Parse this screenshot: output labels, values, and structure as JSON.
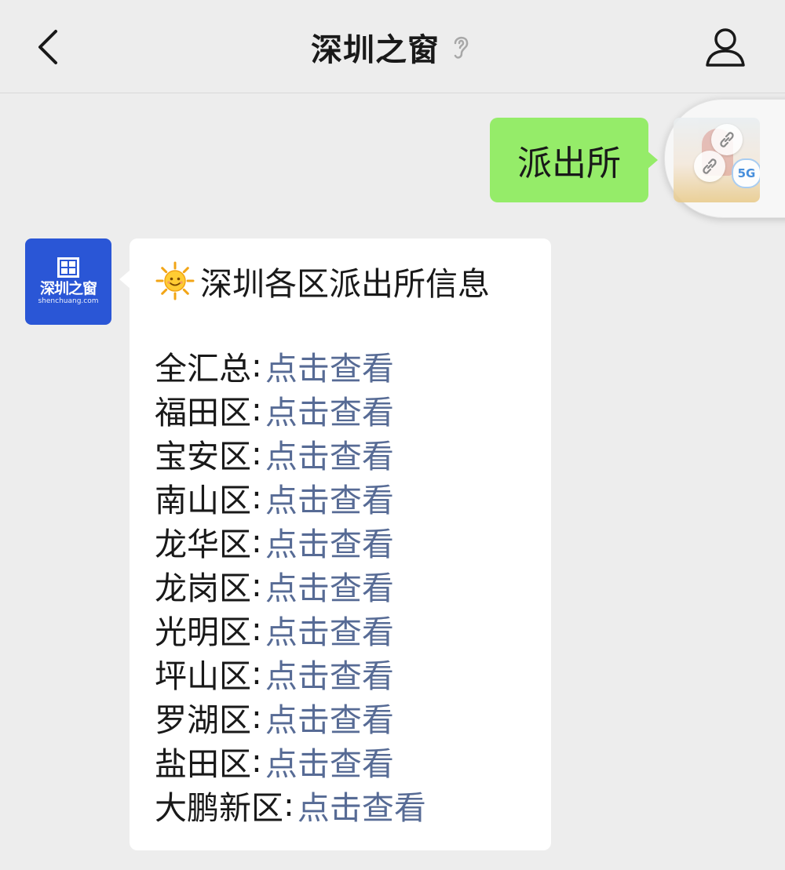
{
  "header": {
    "title": "深圳之窗"
  },
  "outgoing": {
    "text": "派出所",
    "avatar_badge": "5G"
  },
  "incoming": {
    "avatar": {
      "logo_text": "深圳之窗",
      "logo_sub": "shenchuang.com"
    },
    "heading": "深圳各区派出所信息",
    "separator": ":",
    "rows": [
      {
        "district": "全汇总",
        "link": "点击查看"
      },
      {
        "district": "福田区",
        "link": "点击查看"
      },
      {
        "district": "宝安区",
        "link": "点击查看"
      },
      {
        "district": "南山区",
        "link": "点击查看"
      },
      {
        "district": "龙华区",
        "link": "点击查看"
      },
      {
        "district": "龙岗区",
        "link": "点击查看"
      },
      {
        "district": "光明区",
        "link": "点击查看"
      },
      {
        "district": "坪山区",
        "link": "点击查看"
      },
      {
        "district": "罗湖区",
        "link": "点击查看"
      },
      {
        "district": "盐田区",
        "link": "点击查看"
      },
      {
        "district": "大鹏新区",
        "link": "点击查看"
      }
    ]
  },
  "colors": {
    "background": "#ededed",
    "outgoing_bubble": "#95ec69",
    "link": "#576b95",
    "avatar_blue": "#2a56d6"
  }
}
